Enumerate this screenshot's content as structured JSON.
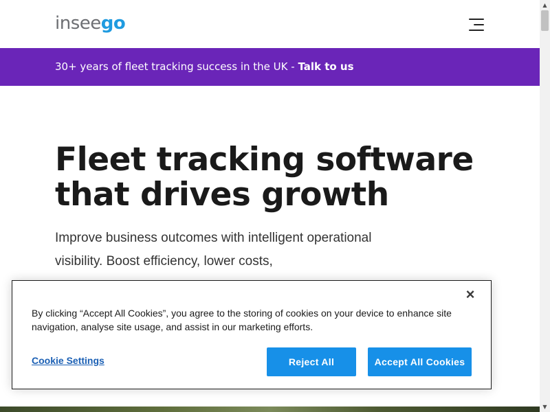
{
  "header": {
    "logo_part1": "insee",
    "logo_part2": "go",
    "menu_icon": "hamburger-menu-icon"
  },
  "promo": {
    "text": "30+ years of fleet tracking success in the UK - ",
    "link": "Talk to us",
    "bg_color": "#6a25b8"
  },
  "hero": {
    "title_line1": "Fleet tracking software",
    "title_line2": "that drives growth",
    "subtitle": "Improve business outcomes with intelligent operational visibility. Boost efficiency, lower costs,"
  },
  "cookie": {
    "text": "By clicking “Accept All Cookies”, you agree to the storing of cookies on your device to enhance site navigation, analyse site usage, and assist in our marketing efforts.",
    "settings_label": "Cookie Settings",
    "reject_label": "Reject All",
    "accept_label": "Accept All Cookies",
    "close_icon": "close-icon",
    "button_color": "#1790e8"
  }
}
